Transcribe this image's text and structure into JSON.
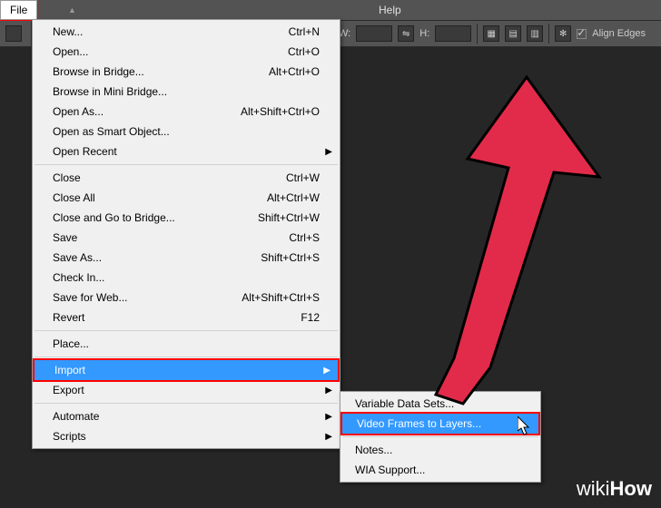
{
  "menubar": {
    "file": "File",
    "help": "Help"
  },
  "toolbar": {
    "wlabel": "W:",
    "hlabel": "H:",
    "align_edges": "Align Edges"
  },
  "file_menu": {
    "new": "New...",
    "new_sc": "Ctrl+N",
    "open": "Open...",
    "open_sc": "Ctrl+O",
    "browse_bridge": "Browse in Bridge...",
    "browse_bridge_sc": "Alt+Ctrl+O",
    "browse_mini": "Browse in Mini Bridge...",
    "open_as": "Open As...",
    "open_as_sc": "Alt+Shift+Ctrl+O",
    "open_smart": "Open as Smart Object...",
    "open_recent": "Open Recent",
    "close": "Close",
    "close_sc": "Ctrl+W",
    "close_all": "Close All",
    "close_all_sc": "Alt+Ctrl+W",
    "close_bridge": "Close and Go to Bridge...",
    "close_bridge_sc": "Shift+Ctrl+W",
    "save": "Save",
    "save_sc": "Ctrl+S",
    "save_as": "Save As...",
    "save_as_sc": "Shift+Ctrl+S",
    "checkin": "Check In...",
    "save_web": "Save for Web...",
    "save_web_sc": "Alt+Shift+Ctrl+S",
    "revert": "Revert",
    "revert_sc": "F12",
    "place": "Place...",
    "import": "Import",
    "export": "Export",
    "automate": "Automate",
    "scripts": "Scripts"
  },
  "submenu": {
    "varsets": "Variable Data Sets...",
    "vframes": "Video Frames to Layers...",
    "notes": "Notes...",
    "wia": "WIA Support..."
  },
  "watermark": {
    "wiki": "wiki",
    "how": "How"
  }
}
